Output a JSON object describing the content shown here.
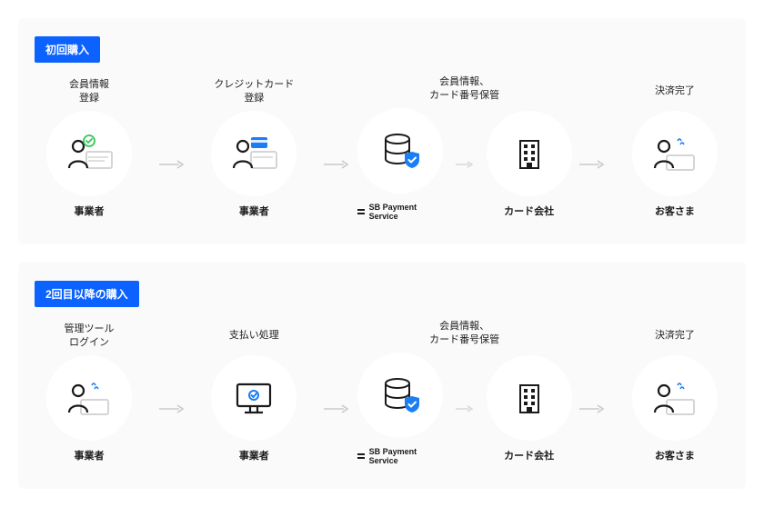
{
  "sections": [
    {
      "badge": "初回購入",
      "steps": [
        {
          "titleA": "会員情報",
          "titleB": "登録",
          "caption": "事業者",
          "icon": "person-register"
        },
        {
          "titleA": "クレジットカード",
          "titleB": "登録",
          "caption": "事業者",
          "icon": "person-card"
        },
        {
          "titleA": "会員情報、",
          "titleB": "カード番号保管",
          "caption": "SB Payment Service",
          "caption_card": "カード会社",
          "icon": "db-building",
          "wide": true
        },
        {
          "titleA": "決済完了",
          "titleB": "",
          "caption": "お客さま",
          "icon": "customer"
        }
      ]
    },
    {
      "badge": "2回目以降の購入",
      "steps": [
        {
          "titleA": "管理ツール",
          "titleB": "ログイン",
          "caption": "事業者",
          "icon": "person-login"
        },
        {
          "titleA": "支払い処理",
          "titleB": "",
          "caption": "事業者",
          "icon": "monitor"
        },
        {
          "titleA": "会員情報、",
          "titleB": "カード番号保管",
          "caption": "SB Payment Service",
          "caption_card": "カード会社",
          "icon": "db-building",
          "wide": true
        },
        {
          "titleA": "決済完了",
          "titleB": "",
          "caption": "お客さま",
          "icon": "customer"
        }
      ]
    }
  ]
}
